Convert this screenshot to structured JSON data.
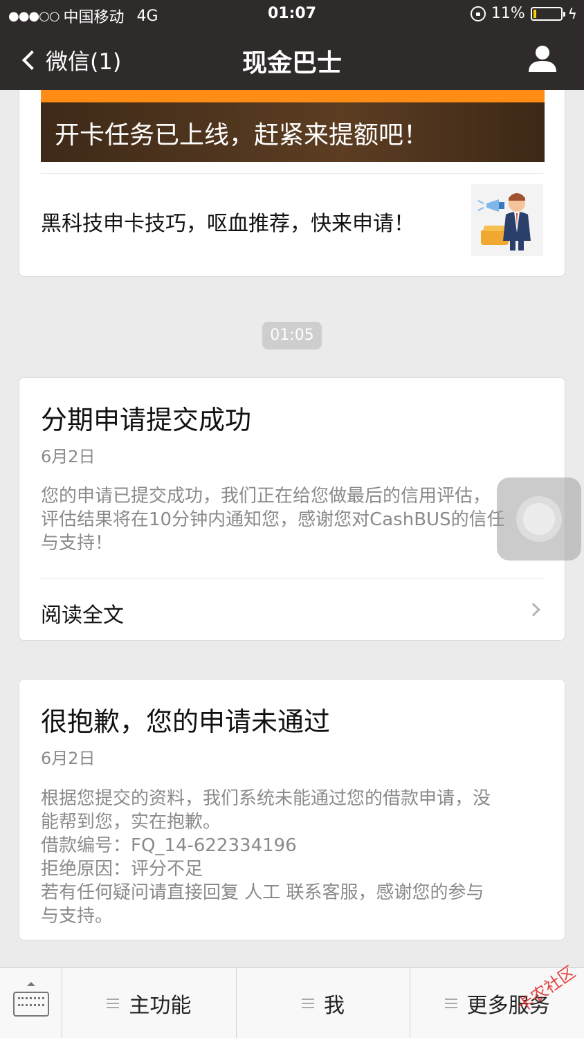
{
  "status_bar": {
    "carrier": "中国移动",
    "network": "4G",
    "time": "01:07",
    "battery": "11%",
    "battery_level": 0.11
  },
  "nav": {
    "back_label": "微信(1)",
    "title": "现金巴士"
  },
  "articles": {
    "banner_text": "开卡任务已上线，赶紧来提额吧！",
    "sub_item_text": "黑科技申卡技巧，呕血推荐，快来申请！"
  },
  "timestamp": "01:05",
  "card_success": {
    "title": "分期申请提交成功",
    "date": "6月2日",
    "body_lines": [
      "您的申请已提交成功，我们正在给您做最后的信用评估，",
      "评估结果将在10分钟内通知您，感谢您对CashBUS的信任",
      "与支持！"
    ],
    "read_more": "阅读全文"
  },
  "card_rejected": {
    "title": "很抱歉，您的申请未通过",
    "date": "6月2日",
    "body_lines": [
      "根据您提交的资料，我们系统未能通过您的借款申请，没",
      "能帮到您，实在抱歉。",
      "借款编号：FQ_14-622334196",
      "拒绝原因：评分不足",
      "若有任何疑问请直接回复 人工 联系客服，感谢您的参与",
      "与支持。"
    ]
  },
  "menu": {
    "items": [
      "主功能",
      "我",
      "更多服务"
    ]
  },
  "watermark": "卡农社区",
  "colors": {
    "header_bg": "#2e2b2a",
    "page_bg": "#ebebeb",
    "banner_orange": "#ff8c14"
  }
}
